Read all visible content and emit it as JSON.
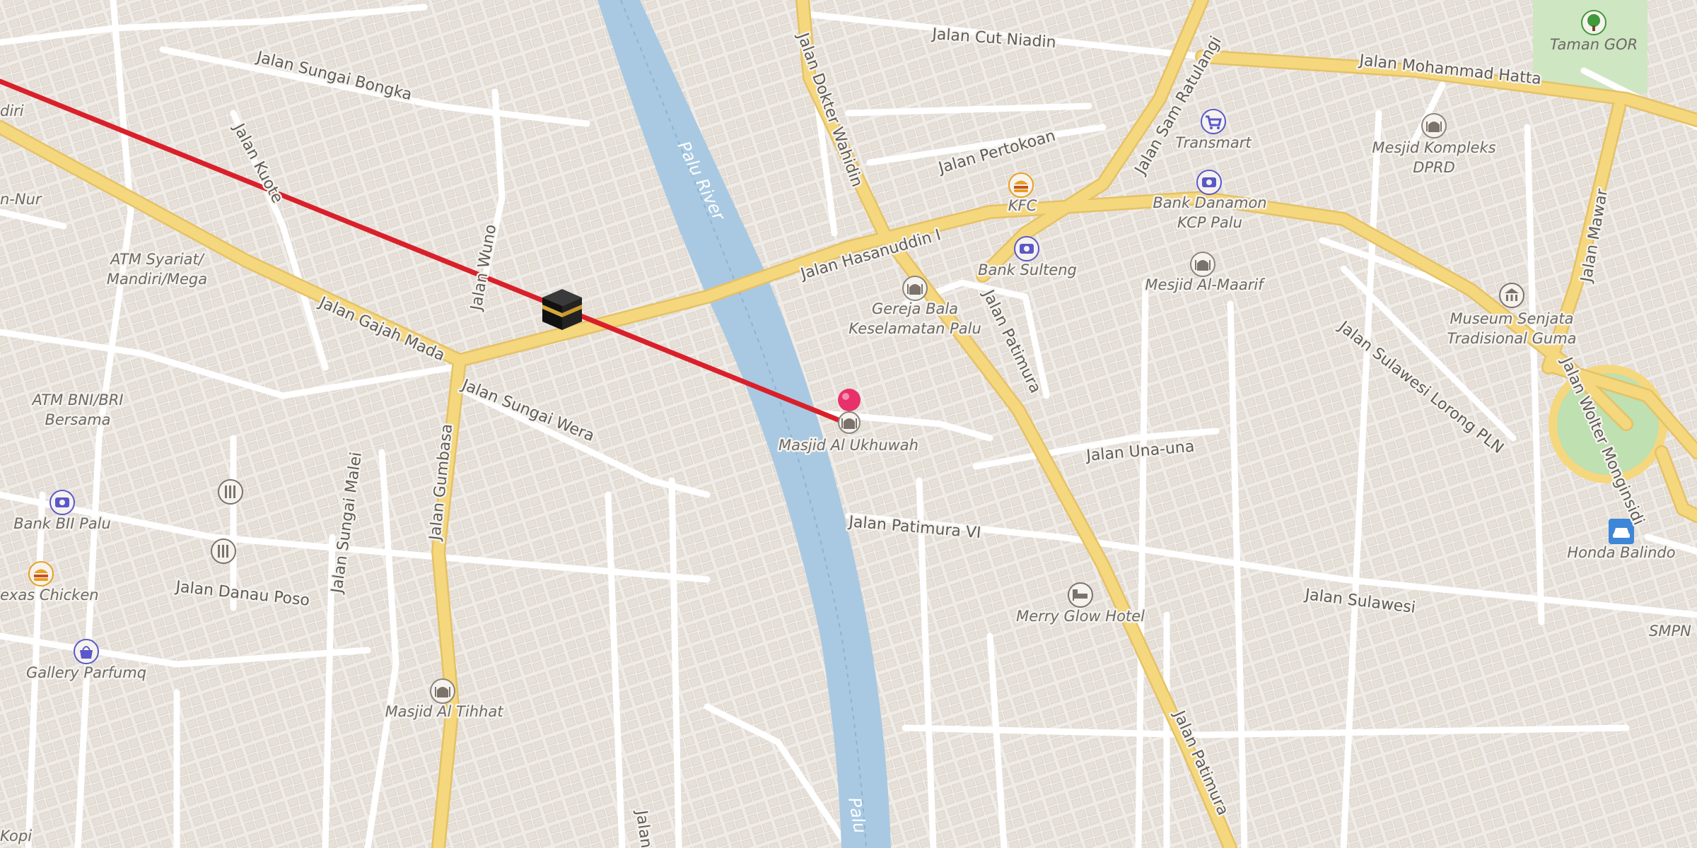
{
  "colors": {
    "background": "#f1eeea",
    "river": "#a9c9e2",
    "major_road": "#f5d77e",
    "minor_road": "#ffffff",
    "route_line": "#d9202a",
    "park": "#cfe6c2",
    "pin": "#e8316a"
  },
  "river": {
    "name": "Palu River",
    "name_lower": "Palu"
  },
  "roads": {
    "gajah_mada": "Jalan Gajah Mada",
    "hasanuddin": "Jalan Hasanuddin I",
    "patimura": "Jalan Patimura",
    "patimura_lower": "Jalan Patimura",
    "patimura_vi": "Jalan Patimura VI",
    "sulawesi": "Jalan Sulawesi",
    "sulawesi_lorong": "Jalan Sulawesi Lorong PLN",
    "una_una": "Jalan Una-una",
    "sungai_wera": "Jalan Sungai Wera",
    "sungai_bongka": "Jalan Sungai Bongka",
    "kuote": "Jalan Kuote",
    "wuno": "Jalan Wuno",
    "gumbasa": "Jalan Gumbasa",
    "sungai_malei": "Jalan Sungai Malei",
    "danau_poso": "Jalan Danau Poso",
    "dokter_wahidin": "Jalan Dokter Wahidin",
    "pertokoan": "Jalan Pertokoan",
    "cut_niadin": "Jalan Cut Niadin",
    "sam_ratulangi": "Jalan Sam Ratulangi",
    "mohammad_hatta": "Jalan Mohammad Hatta",
    "mawar": "Jalan Mawar",
    "wolter_monginsidi": "Jalan Wolter Monginsidi",
    "bottom_partial": "Jalan"
  },
  "pois": {
    "masjid_ukhuwah": "Masjid Al Ukhuwah",
    "gereja_1": "Gereja Bala",
    "gereja_2": "Keselamatan Palu",
    "bank_sulteng": "Bank Sulteng",
    "kfc": "KFC",
    "bank_danamon_1": "Bank Danamon",
    "bank_danamon_2": "KCP Palu",
    "mesjid_maarif": "Mesjid Al-Maarif",
    "transmart": "Transmart",
    "mesjid_dprd_1": "Mesjid Kompleks",
    "mesjid_dprd_2": "DPRD",
    "taman_gor": "Taman GOR",
    "museum_1": "Museum Senjata",
    "museum_2": "Tradisional Guma",
    "honda": "Honda Balindo",
    "smpn": "SMPN",
    "merry_glow": "Merry Glow Hotel",
    "masjid_tihhat": "Masjid Al Tihhat",
    "atm_bni_1": "ATM BNI/BRI",
    "atm_bni_2": "Bersama",
    "atm_syariah_1": "ATM Syariat/",
    "atm_syariah_2": "Mandiri/Mega",
    "bank_bii": "Bank BII Palu",
    "texas": "exas Chicken",
    "gallery": "Gallery Parfumq",
    "an_nur": "n-Nur",
    "diri": "diri",
    "kopi": "Kopi"
  },
  "icons": {
    "kaaba": "kaaba-icon",
    "pin": "map-pin-icon",
    "mosque": "mosque-icon",
    "bank": "bank-icon",
    "food": "fast-food-icon",
    "shop": "shopping-cart-icon",
    "museum": "museum-icon",
    "car": "car-icon",
    "hotel": "bed-icon",
    "tree": "tree-icon",
    "bag": "shopping-bag-icon",
    "library": "library-icon"
  }
}
